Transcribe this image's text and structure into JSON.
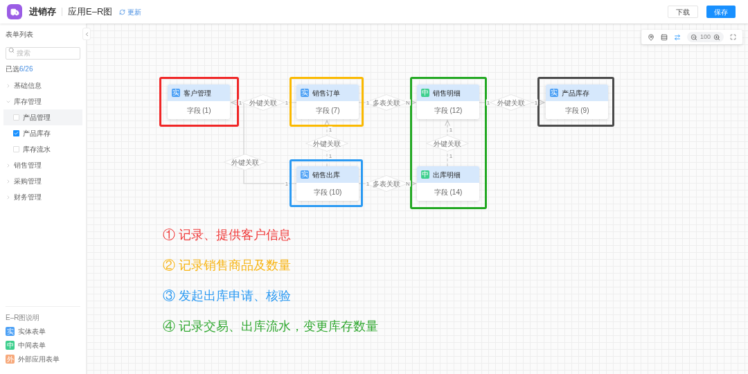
{
  "header": {
    "app_name": "进销存",
    "page_title": "应用E–R图",
    "update_link": "更新",
    "buttons": [
      {
        "label": "下载",
        "kind": "secondary"
      },
      {
        "label": "保存",
        "kind": "primary"
      }
    ]
  },
  "sidebar": {
    "title": "表单列表",
    "search": {
      "placeholder": "搜索"
    },
    "selected_label": "已选",
    "selected_count": "6/26",
    "groups": [
      {
        "label": "基础信息",
        "expanded": false
      },
      {
        "label": "库存管理",
        "expanded": true,
        "children": [
          {
            "label": "产品管理",
            "checked": false,
            "highlighted": true
          },
          {
            "label": "产品库存",
            "checked": true,
            "highlighted": false
          },
          {
            "label": "库存流水",
            "checked": false,
            "highlighted": false
          }
        ]
      },
      {
        "label": "销售管理",
        "expanded": false
      },
      {
        "label": "采购管理",
        "expanded": false
      },
      {
        "label": "财务管理",
        "expanded": false
      }
    ],
    "legend": {
      "title": "E–R图说明",
      "items": [
        {
          "badge": "实",
          "label": "实体表单",
          "color": "#4a9ff5"
        },
        {
          "badge": "中",
          "label": "中间表单",
          "color": "#3ecf8e"
        },
        {
          "badge": "外",
          "label": "外部应用表单",
          "color": "#f7a97b"
        }
      ]
    }
  },
  "toolbar": {
    "tools": [
      {
        "kind": "locate",
        "active": false
      },
      {
        "kind": "align",
        "active": false
      },
      {
        "kind": "layout",
        "active": true
      }
    ],
    "zoom_level": "100"
  },
  "diagram": {
    "tables": [
      {
        "name": "客户管理",
        "badge": "实",
        "kind": "entity",
        "fields": "字段 (1)"
      },
      {
        "name": "销售订单",
        "badge": "实",
        "kind": "entity",
        "fields": "字段 (7)"
      },
      {
        "name": "销售明细",
        "badge": "中",
        "kind": "middle",
        "fields": "字段 (12)"
      },
      {
        "name": "产品库存",
        "badge": "实",
        "kind": "entity",
        "fields": "字段 (9)"
      },
      {
        "name": "销售出库",
        "badge": "实",
        "kind": "entity",
        "fields": "字段 (10)"
      },
      {
        "name": "出库明细",
        "badge": "中",
        "kind": "middle",
        "fields": "字段 (14)"
      }
    ],
    "relations": [
      {
        "label": "外键关联",
        "cardinality": [
          "1",
          "1"
        ]
      },
      {
        "label": "多表关联",
        "cardinality": [
          "1",
          "N"
        ]
      },
      {
        "label": "外键关联",
        "cardinality": [
          "1",
          "1"
        ]
      },
      {
        "label": "外键关联",
        "cardinality": [
          "1",
          "1"
        ]
      },
      {
        "label": "外键关联",
        "cardinality": [
          "1",
          "1"
        ]
      },
      {
        "label": "外键关联",
        "cardinality": [
          "1"
        ]
      },
      {
        "label": "多表关联",
        "cardinality": [
          "1",
          "N"
        ]
      }
    ],
    "highlights": [
      {
        "color": "#f02626"
      },
      {
        "color": "#fbb900"
      },
      {
        "color": "#22a822"
      },
      {
        "color": "#4a4a4a"
      },
      {
        "color": "#2b9af3"
      }
    ],
    "notes": [
      {
        "text": "① 记录、提供客户信息",
        "color": "#f03a3a"
      },
      {
        "text": "② 记录销售商品及数量",
        "color": "#f8b515"
      },
      {
        "text": "③ 发起出库申请、核验",
        "color": "#2b9af3"
      },
      {
        "text": "④ 记录交易、出库流水，变更库存数量",
        "color": "#31a831"
      }
    ]
  }
}
